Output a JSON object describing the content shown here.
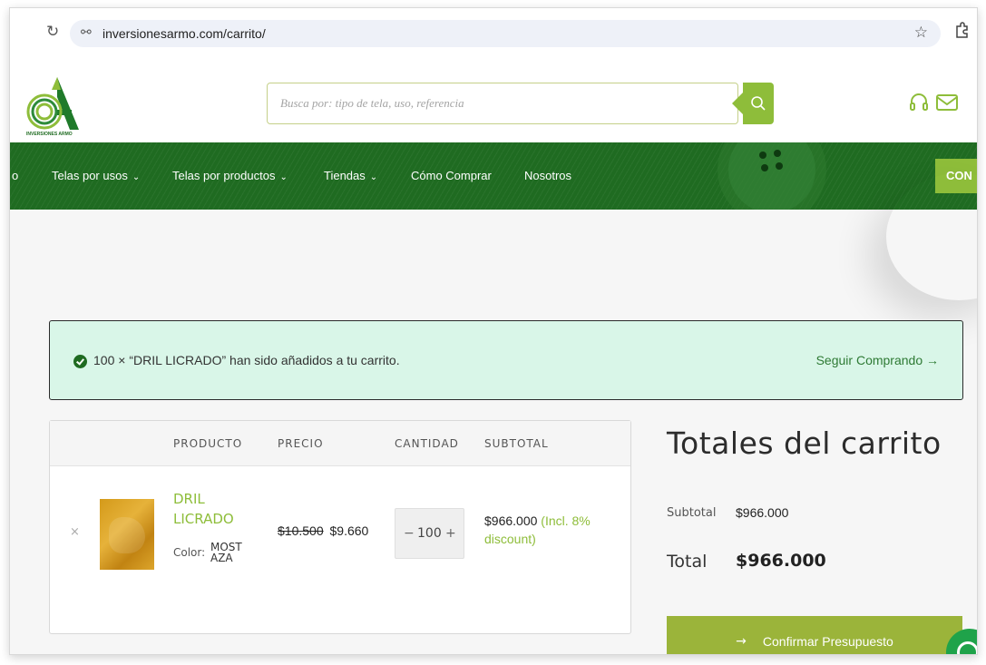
{
  "browser": {
    "url": "inversionesarmo.com/carrito/",
    "reload_icon": "reload-icon",
    "site_info_icon": "tune-icon",
    "star_icon": "star-icon",
    "extensions_icon": "extensions-icon"
  },
  "header": {
    "brand": "INVERSIONES ARMO",
    "search_placeholder": "Busca por: tipo de tela, uso, referencia",
    "search_icon": "search-icon",
    "icons": [
      "headset-icon",
      "mail-icon"
    ]
  },
  "nav": {
    "cut_item": "o",
    "items": [
      {
        "label": "Telas por usos",
        "chevron": "⌄"
      },
      {
        "label": "Telas por productos",
        "chevron": "⌄"
      },
      {
        "label": "Tiendas",
        "chevron": "⌄"
      },
      {
        "label": "Cómo Comprar"
      },
      {
        "label": "Nosotros"
      }
    ],
    "cta": "CON"
  },
  "notice": {
    "message": "100 × “DRIL LICRADO” han sido añadidos a tu carrito.",
    "link": "Seguir Comprando →",
    "icon": "check-circle-icon"
  },
  "cart": {
    "headers": [
      "PRODUCTO",
      "PRECIO",
      "CANTIDAD",
      "SUBTOTAL"
    ],
    "items": [
      {
        "remove": "×",
        "name": "DRIL LICRADO",
        "color_label": "Color:",
        "color_value": "MOSTAZA",
        "price_old": "$10.500",
        "price_new": "$9.660",
        "quantity": "100",
        "qty_minus": "−",
        "qty_plus": "+",
        "subtotal": "$966.000",
        "subtotal_note": "(Incl. 8% discount)"
      }
    ]
  },
  "totals": {
    "title": "Totales del carrito",
    "subtotal_label": "Subtotal",
    "subtotal_value": "$966.000",
    "total_label": "Total",
    "total_value": "$966.000",
    "button_arrow": "→",
    "button": "Confirmar Presupuesto"
  },
  "colors": {
    "brand_green": "#1f6b21",
    "accent_lime": "#8ebd3a",
    "button_olive": "#9bb43a",
    "notice_bg": "#d9f6e8"
  }
}
